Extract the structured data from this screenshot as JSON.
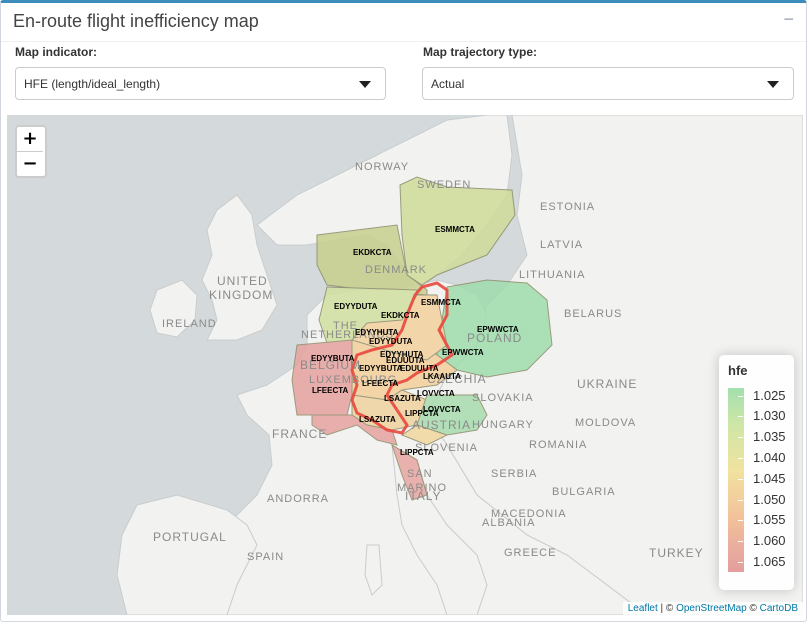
{
  "header": {
    "title": "En-route flight inefficiency map",
    "collapse_icon": "−"
  },
  "controls": {
    "indicator": {
      "label": "Map indicator:",
      "value": "HFE (length/ideal_length)"
    },
    "trajectory": {
      "label": "Map trajectory type:",
      "value": "Actual"
    }
  },
  "zoom": {
    "in": "+",
    "out": "−"
  },
  "countries": [
    {
      "name": "NORWAY"
    },
    {
      "name": "SWEDEN"
    },
    {
      "name": "ESTONIA"
    },
    {
      "name": "LATVIA"
    },
    {
      "name": "LITHUANIA"
    },
    {
      "name": "DENMARK"
    },
    {
      "name": "UNITED"
    },
    {
      "name": "KINGDOM"
    },
    {
      "name": "IRELAND"
    },
    {
      "name": "BELARUS"
    },
    {
      "name": "POLAND"
    },
    {
      "name": "THE"
    },
    {
      "name": "NETHERLANDS"
    },
    {
      "name": "BELGIUM"
    },
    {
      "name": "LUXEMBOURG"
    },
    {
      "name": "CZECHIA"
    },
    {
      "name": "UKRAINE"
    },
    {
      "name": "SLOVAKIA"
    },
    {
      "name": "MOLDOVA"
    },
    {
      "name": "HUNGARY"
    },
    {
      "name": "AUSTRIA"
    },
    {
      "name": "FRANCE"
    },
    {
      "name": "ROMANIA"
    },
    {
      "name": "SLOVENIA"
    },
    {
      "name": "SERBIA"
    },
    {
      "name": "SAN"
    },
    {
      "name": "MARINO"
    },
    {
      "name": "BULGARIA"
    },
    {
      "name": "ANDORRA"
    },
    {
      "name": "ITALY"
    },
    {
      "name": "MACEDONIA"
    },
    {
      "name": "ALBANIA"
    },
    {
      "name": "PORTUGAL"
    },
    {
      "name": "SPAIN"
    },
    {
      "name": "GREECE"
    },
    {
      "name": "TURKEY"
    }
  ],
  "region_labels": [
    {
      "name": "ESMMCTA",
      "hfe": 1.035
    },
    {
      "name": "EKDKCTA",
      "hfe": 1.04
    },
    {
      "name": "ESMMCTA",
      "hfe": 1.047
    },
    {
      "name": "EDYYDUTA",
      "hfe": 1.035
    },
    {
      "name": "EKDKCTA",
      "hfe": 1.047
    },
    {
      "name": "EPWWCTA",
      "hfe": 1.027
    },
    {
      "name": "EDYYHUTA",
      "hfe": 1.045
    },
    {
      "name": "EDYYDUTA",
      "hfe": 1.045
    },
    {
      "name": "EPWWCTA",
      "hfe": 1.03
    },
    {
      "name": "EDYYBUTA",
      "hfe": 1.06
    },
    {
      "name": "EDYYHUTA",
      "hfe": 1.05
    },
    {
      "name": "EDUUUTA",
      "hfe": 1.048
    },
    {
      "name": "EDYYBUTA",
      "hfe": 1.055
    },
    {
      "name": "EDUUUTA",
      "hfe": 1.05
    },
    {
      "name": "LKAAUTA",
      "hfe": 1.035
    },
    {
      "name": "LFEECTA",
      "hfe": 1.062
    },
    {
      "name": "LFEECTA",
      "hfe": 1.058
    },
    {
      "name": "LSAZUTA",
      "hfe": 1.05
    },
    {
      "name": "LOVVCTA",
      "hfe": 1.032
    },
    {
      "name": "LOVVCTA",
      "hfe": 1.03
    },
    {
      "name": "LIPPCTA",
      "hfe": 1.052
    },
    {
      "name": "LSAZUTA",
      "hfe": 1.062
    },
    {
      "name": "LIPPCTA",
      "hfe": 1.065
    }
  ],
  "legend": {
    "title": "hfe",
    "ticks": [
      "1.025",
      "1.030",
      "1.035",
      "1.040",
      "1.045",
      "1.050",
      "1.055",
      "1.060",
      "1.065"
    ],
    "colors": [
      "#a3dfae",
      "#cfe7a6",
      "#f1e29f",
      "#f2c29a",
      "#e39d9e"
    ]
  },
  "attribution": {
    "leaflet": "Leaflet",
    "sep1": " | © ",
    "osm": "OpenStreetMap",
    "sep2": " © ",
    "carto": "CartoDB"
  }
}
